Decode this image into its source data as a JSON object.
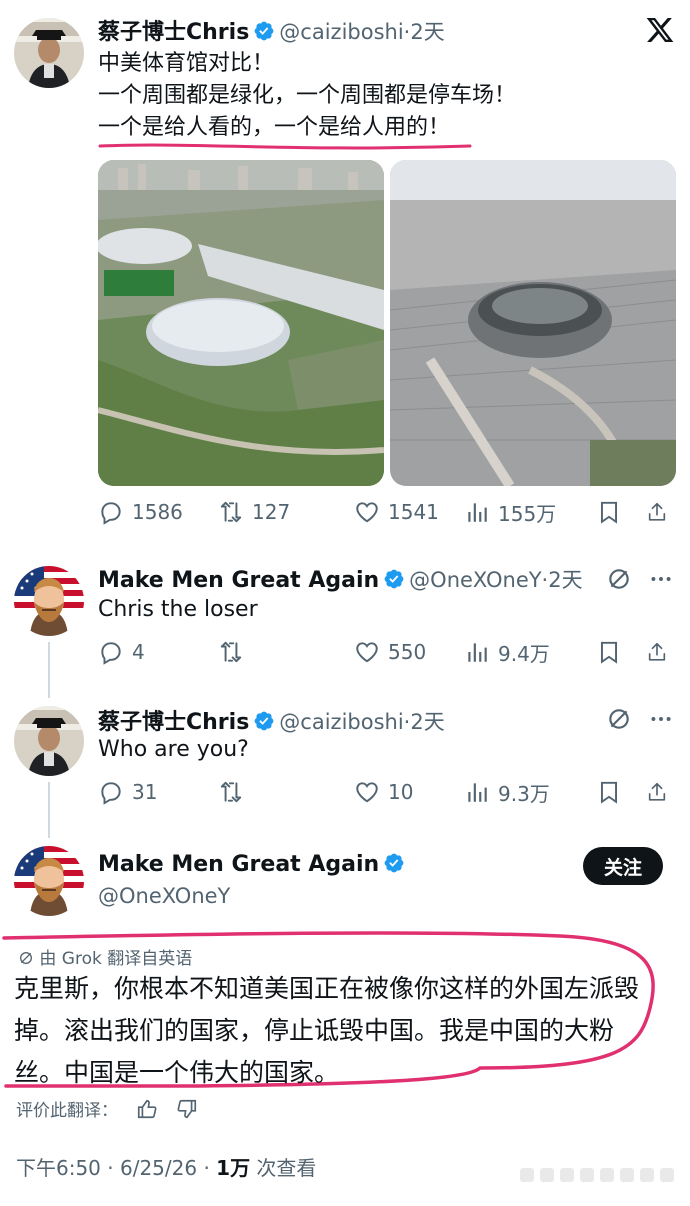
{
  "tweet1": {
    "name": "蔡子博士Chris",
    "handle": "@caiziboshi·2天",
    "lines": [
      "中美体育馆对比！",
      "一个周围都是绿化，一个周围都是停车场！",
      "一个是给人看的，一个是给人用的！"
    ],
    "stats": {
      "replies": "1586",
      "retweets": "127",
      "likes": "1541",
      "views": "155万"
    }
  },
  "reply1": {
    "name": "Make Men Great Again",
    "handle": "@OneXOneY·2天",
    "text": "Chris the loser",
    "stats": {
      "replies": "4",
      "likes": "550",
      "views": "9.4万"
    }
  },
  "reply2": {
    "name": "蔡子博士Chris",
    "handle": "@caiziboshi·2天",
    "text": "Who are you?",
    "stats": {
      "replies": "31",
      "likes": "10",
      "views": "9.3万"
    }
  },
  "main": {
    "name": "Make Men Great Again",
    "handle": "@OneXOneY",
    "follow_label": "关注",
    "translate_label": "由 Grok 翻译自英语",
    "translated_text": "克里斯，你根本不知道美国正在被像你这样的外国左派毁掉。滚出我们的国家，停止诋毁中国。我是中国的大粉丝。中国是一个伟大的国家。",
    "rate_label": "评价此翻译：",
    "time": "下午6:50 · 6/25/26 · ",
    "views_count": "1万",
    "views_label": " 次查看"
  },
  "colors": {
    "verified": "#1d9bf0",
    "annotation": "#e0306f",
    "text": "#0f1419",
    "muted": "#536471"
  },
  "icons": [
    "reply-icon",
    "retweet-icon",
    "like-icon",
    "views-icon",
    "bookmark-icon",
    "share-icon",
    "grok-icon",
    "x-logo-icon",
    "more-icon"
  ]
}
